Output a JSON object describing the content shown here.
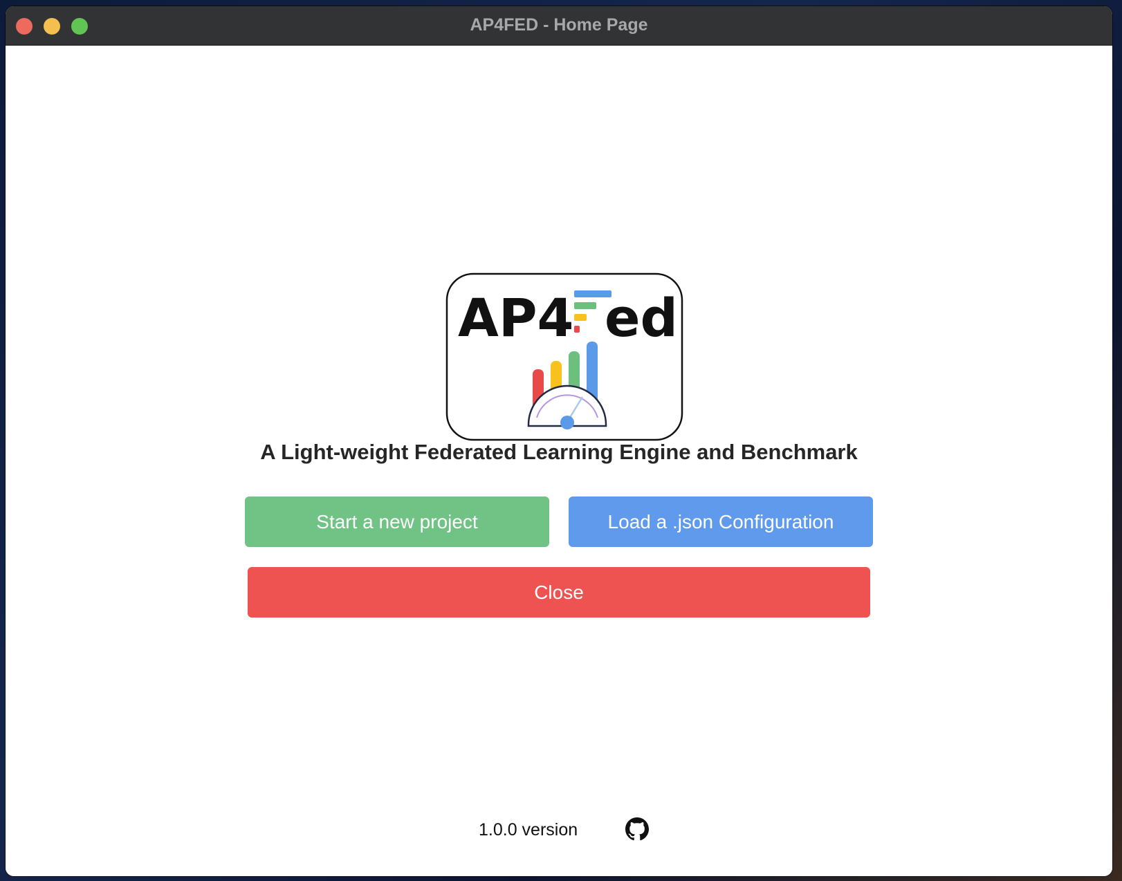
{
  "window": {
    "title": "AP4FED - Home Page"
  },
  "logo": {
    "text": "AP4Fed",
    "colors": {
      "red": "#e84a4a",
      "yellow": "#f7c21c",
      "green": "#6dbf7d",
      "blue": "#5b9ae8",
      "purple": "#b894e0"
    }
  },
  "main": {
    "tagline": "A Light-weight Federated Learning Engine and Benchmark",
    "start_label": "Start a new project",
    "load_label": "Load a .json Configuration",
    "close_label": "Close"
  },
  "footer": {
    "version": "1.0.0 version",
    "github_icon": "github-icon"
  },
  "colors": {
    "start": "#71c385",
    "load": "#5f9aec",
    "close": "#ee5352",
    "titlebar": "#323335"
  }
}
